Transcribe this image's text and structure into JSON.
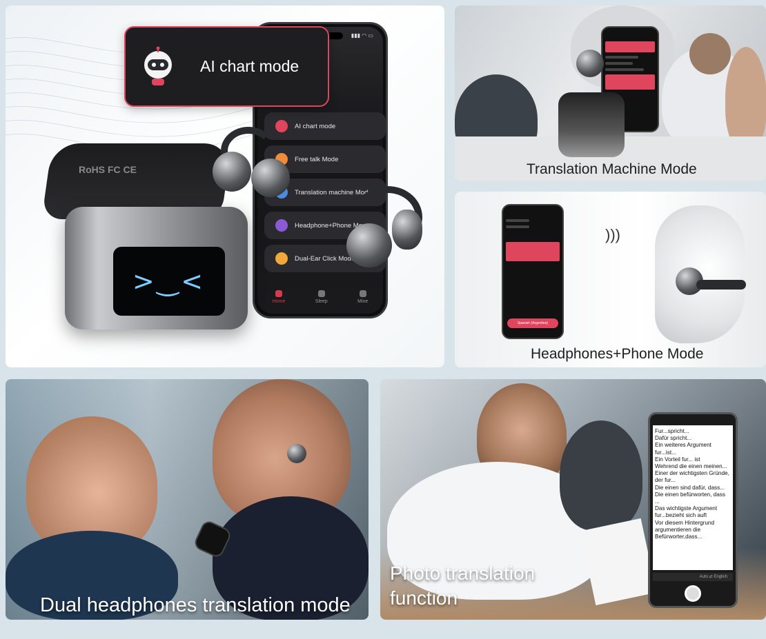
{
  "hero": {
    "banner_label": "AI chart mode",
    "case_marks": "RoHS FC CE",
    "case_face": ">‿<",
    "menu_items": [
      {
        "label": "AI chart mode",
        "color": "#e0455e"
      },
      {
        "label": "Free talk Mode",
        "color": "#f08c3a"
      },
      {
        "label": "Translation machine Mode",
        "color": "#4a8de0"
      },
      {
        "label": "Headphone+Phone Mo",
        "color": "#8a5ad6"
      },
      {
        "label": "Dual-Ear Click Mode",
        "color": "#f0a83a"
      }
    ],
    "tabs": [
      {
        "label": "Home"
      },
      {
        "label": "Sleep"
      },
      {
        "label": "Mine"
      }
    ]
  },
  "panel_translation_machine": {
    "caption": "Translation Machine Mode"
  },
  "panel_headphones_phone": {
    "caption": "Headphones+Phone Mode",
    "phone_button": "Spanish (Argentina)"
  },
  "panel_dual": {
    "caption": "Dual headphones translation mode"
  },
  "panel_photo": {
    "caption_line1": "Photo translation",
    "caption_line2": "function",
    "doc_text": "Fur...spricht...\nDafür spricht...\nEin weiteres Argument\nfur...ist...\nEin Vorteil fur... ist\nWehrend die einen meinen...\nEiner der wichtigsten Gründe,\nder fur...\nDie einen sind dafür, dass...\nDie einen befürworten, dass\n...\nDas wichtigste Argument\nfur...bezieht sich auft\nVor diesem Hintergrund\nargumentieren die\nBefürworter,dass...",
    "lang_bar": "Auto  ⇄  English"
  }
}
